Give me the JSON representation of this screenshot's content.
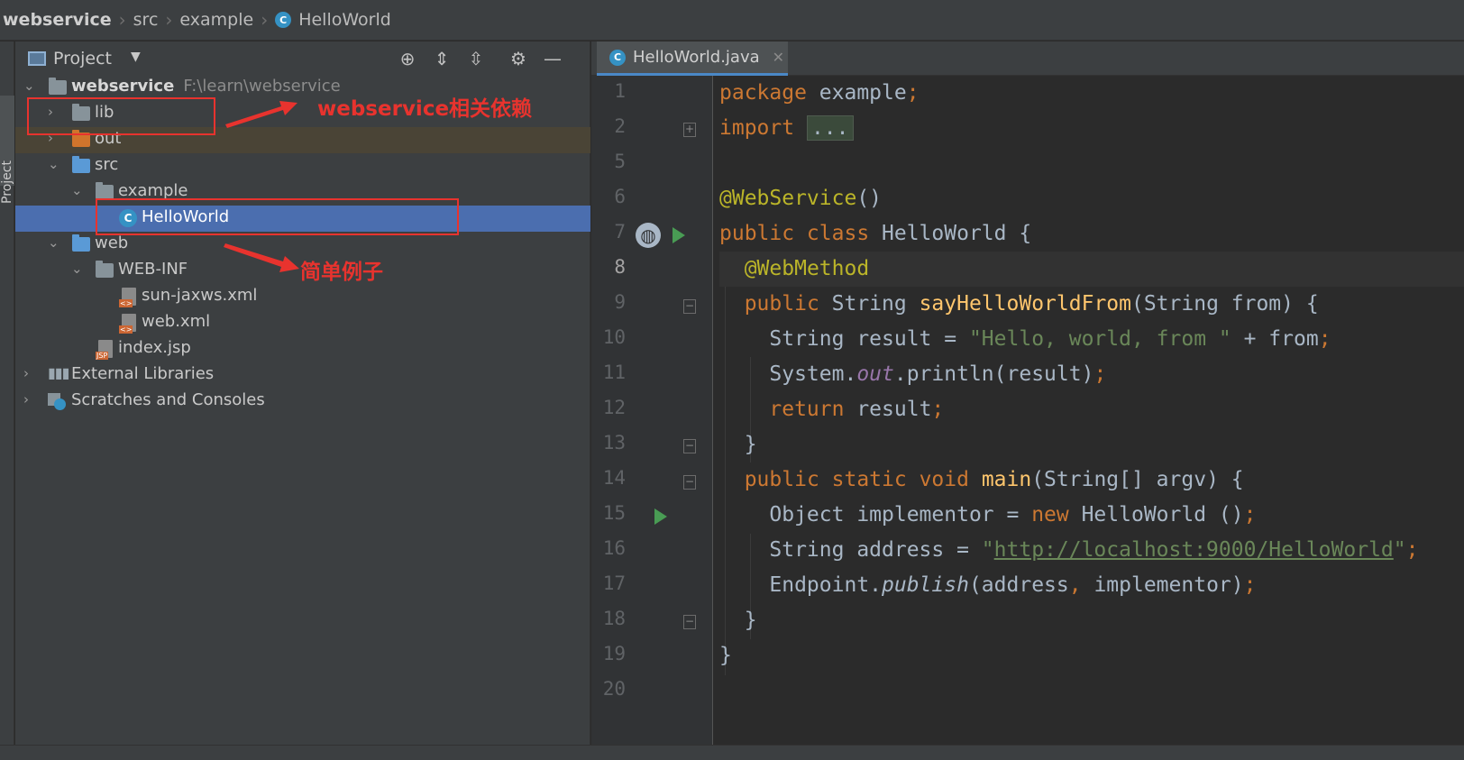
{
  "breadcrumb": [
    "webservice",
    "src",
    "example",
    "HelloWorld"
  ],
  "tool_strip": {
    "label": "Project"
  },
  "project": {
    "title": "Project",
    "tree": [
      {
        "label": "webservice",
        "path": "F:\\learn\\webservice"
      },
      {
        "label": "lib"
      },
      {
        "label": "out"
      },
      {
        "label": "src"
      },
      {
        "label": "example"
      },
      {
        "label": "HelloWorld"
      },
      {
        "label": "web"
      },
      {
        "label": "WEB-INF"
      },
      {
        "label": "sun-jaxws.xml"
      },
      {
        "label": "web.xml"
      },
      {
        "label": "index.jsp"
      },
      {
        "label": "External Libraries"
      },
      {
        "label": "Scratches and Consoles"
      }
    ]
  },
  "annotations": {
    "lib_note": "webservice相关依赖",
    "helloworld_note": "简单例子"
  },
  "editor": {
    "tab_label": "HelloWorld.java",
    "line_numbers": [
      "1",
      "2",
      "5",
      "6",
      "7",
      "8",
      "9",
      "10",
      "11",
      "12",
      "13",
      "14",
      "15",
      "16",
      "17",
      "18",
      "19",
      "20"
    ],
    "code": {
      "l1_kw": "package",
      "l1_rest": " example",
      "l1_semi": ";",
      "l2_kw": "import",
      "l2_fold": "...",
      "l6_ann": "@WebService",
      "l6_rest": "()",
      "l7_kw": "public class",
      "l7_rest": " HelloWorld {",
      "l8_ann": "@WebMethod",
      "l9_kw": "public",
      "l9_a": " String ",
      "l9_fn": "sayHelloWorldFrom",
      "l9_b": "(String from) {",
      "l10_a": "String result = ",
      "l10_str": "\"Hello, world, from \"",
      "l10_b": " + from",
      "l10_semi": ";",
      "l11_a": "System.",
      "l11_fld": "out",
      "l11_b": ".println(result)",
      "l11_semi": ";",
      "l12_kw": "return",
      "l12_b": " result",
      "l12_semi": ";",
      "l13": "}",
      "l14_kw": "public static void",
      "l14_fn": "main",
      "l14_b": "(String[] argv) {",
      "l15_a": "Object implementor = ",
      "l15_kw": "new",
      "l15_b": " HelloWorld ()",
      "l15_semi": ";",
      "l16_a": "String address = ",
      "l16_q1": "\"",
      "l16_url": "http://localhost:9000/HelloWorld",
      "l16_q2": "\"",
      "l16_semi": ";",
      "l17_a": "Endpoint.",
      "l17_it": "publish",
      "l17_b": "(address",
      "l17_comma": ",",
      "l17_c": " implementor)",
      "l17_semi": ";",
      "l18": "}",
      "l19": "}"
    }
  },
  "colors": {
    "keyword": "#cc7832",
    "annotation": "#bbb529",
    "string": "#6a8759",
    "method": "#ffc66d",
    "selection": "#4b6eaf",
    "annotation_red": "#e8332e"
  }
}
